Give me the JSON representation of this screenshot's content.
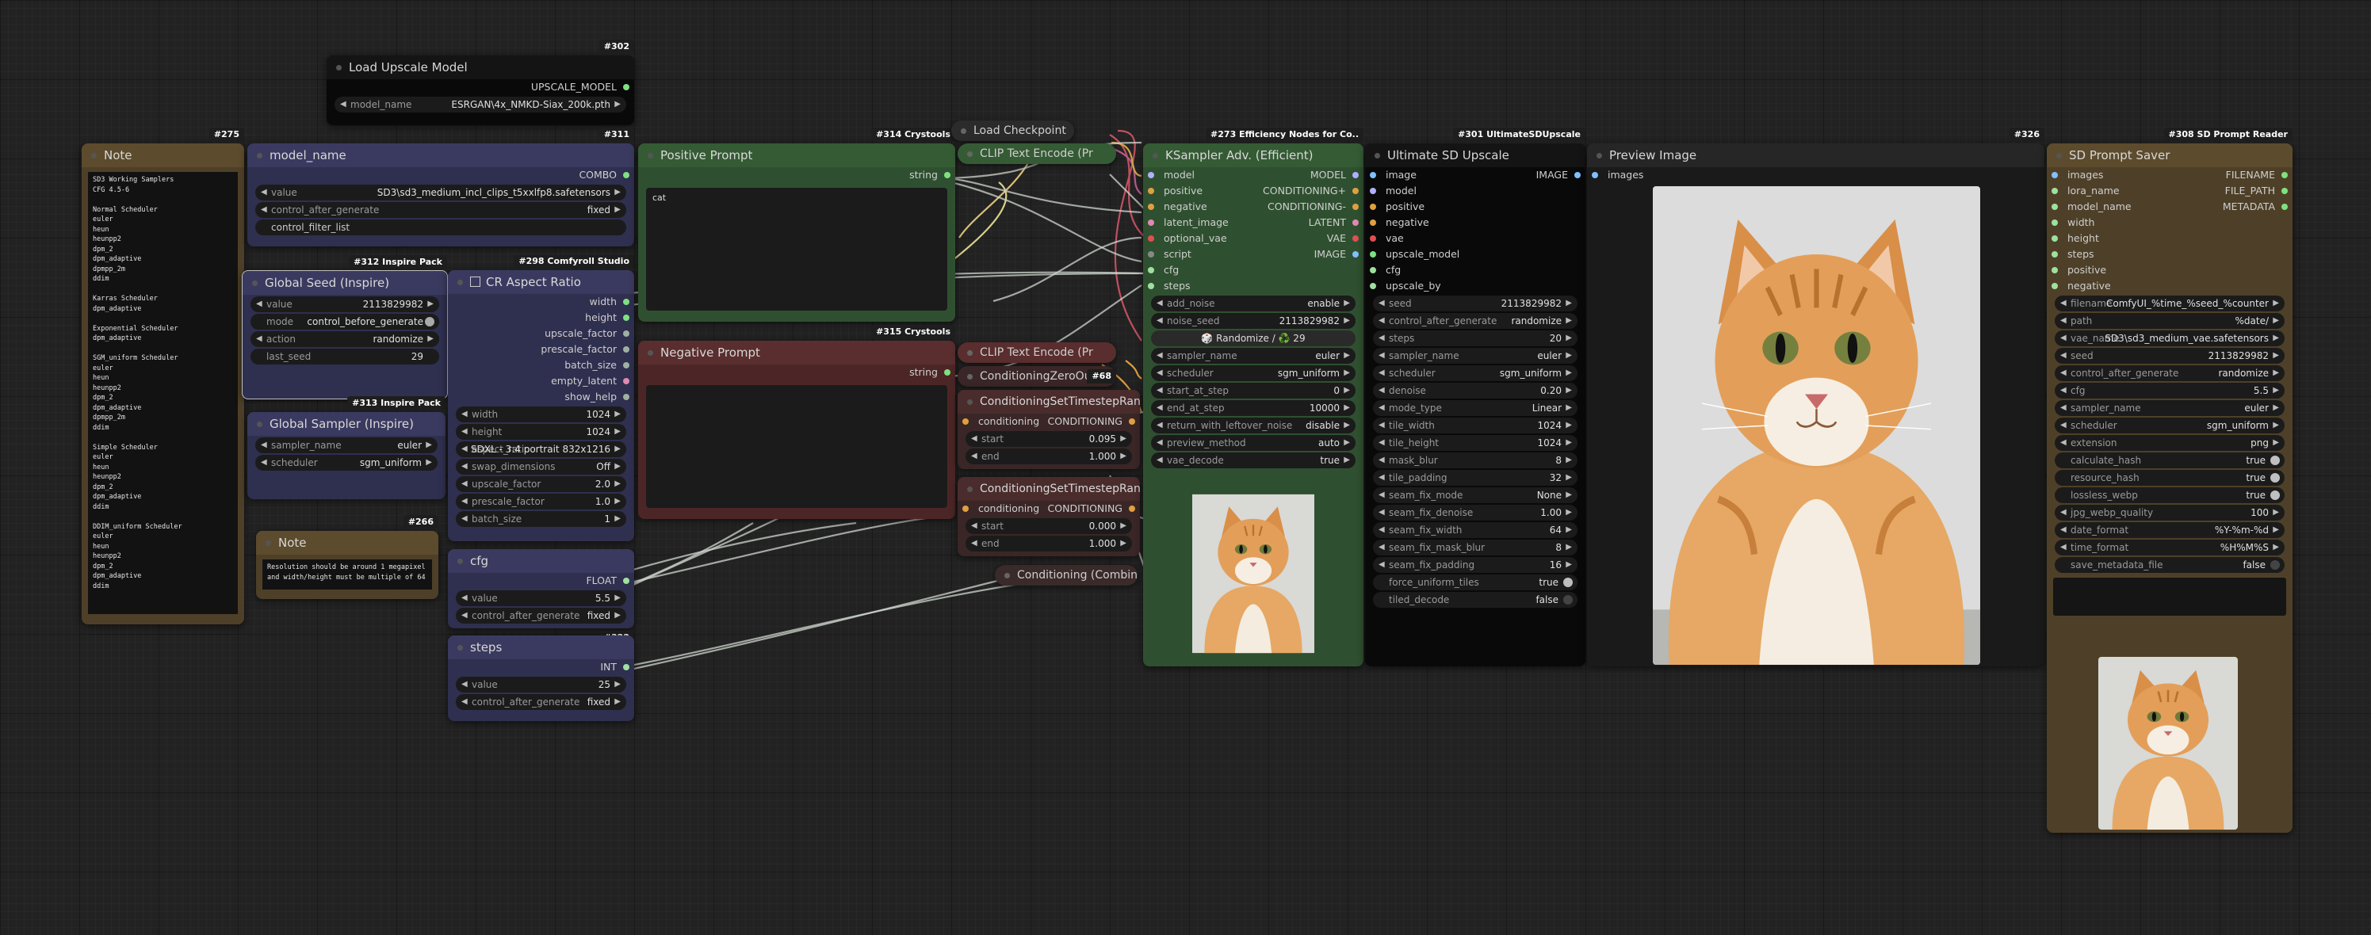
{
  "colors": {
    "bg": "#222222",
    "purple": "#2f2f4f",
    "purpleHdr": "#3a3a60",
    "green": "#2f5030",
    "greenHdr": "#355b35",
    "red": "#4c2626",
    "redHdr": "#5a2e2e",
    "brown": "#4e4028",
    "brownHdr": "#5d4b2d",
    "black": "#090909",
    "gray": "#2b2b2b"
  },
  "note1": {
    "badge": "#275",
    "title": "Note",
    "text": "SD3 Working Samplers\nCFG 4.5-6\n\nNormal Scheduler\neuler\nheun\nheunpp2\ndpm_2\ndpm_adaptive\ndpmpp_2m\nddim\n\nKarras Scheduler\ndpm_adaptive\n\nExponential Scheduler\ndpm_adaptive\n\nSGM_uniform Scheduler\neuler\nheun\nheunpp2\ndpm_2\ndpm_adaptive\ndpmpp_2m\nddim\n\nSimple Scheduler\neuler\nheun\nheunpp2\ndpm_2\ndpm_adaptive\nddim\n\nDDIM_uniform Scheduler\neuler\nheun\nheunpp2\ndpm_2\ndpm_adaptive\nddim"
  },
  "note2": {
    "badge": "#266",
    "title": "Note",
    "text": "Resolution should be around 1 megapixel\nand width/height must be multiple of 64"
  },
  "upscale_model": {
    "badge": "#302",
    "title": "Load Upscale Model",
    "out": "UPSCALE_MODEL",
    "w_label": "model_name",
    "w_value": "ESRGAN\\4x_NMKD-Siax_200k.pth"
  },
  "model_name": {
    "badge": "#311",
    "title": "model_name",
    "out": "COMBO",
    "w1_label": "value",
    "w1_value": "SD3\\sd3_medium_incl_clips_t5xxlfp8.safetensors",
    "w2_label": "control_after_generate",
    "w2_value": "fixed",
    "w3_label": "control_filter_list"
  },
  "global_seed": {
    "badge": "#312 Inspire Pack",
    "title": "Global Seed (Inspire)",
    "rows": [
      {
        "l": "value",
        "v": "2113829982"
      },
      {
        "l": "mode",
        "v": "control_before_generate"
      },
      {
        "l": "action",
        "v": "randomize"
      },
      {
        "l": "last_seed",
        "v": "29"
      }
    ]
  },
  "global_sampler": {
    "badge": "#313 Inspire Pack",
    "title": "Global Sampler (Inspire)",
    "rows": [
      {
        "l": "sampler_name",
        "v": "euler"
      },
      {
        "l": "scheduler",
        "v": "sgm_uniform"
      }
    ]
  },
  "aspect": {
    "badge": "#298 Comfyroll Studio",
    "title": "CR Aspect Ratio",
    "outs": [
      "width",
      "height",
      "upscale_factor",
      "prescale_factor",
      "batch_size",
      "empty_latent",
      "show_help"
    ],
    "rows": [
      {
        "l": "width",
        "v": "1024"
      },
      {
        "l": "height",
        "v": "1024"
      },
      {
        "l": "aspect_ratio",
        "v": "SDXL - 3:4 portrait 832x1216"
      },
      {
        "l": "swap_dimensions",
        "v": "Off"
      },
      {
        "l": "upscale_factor",
        "v": "2.0"
      },
      {
        "l": "prescale_factor",
        "v": "1.0"
      },
      {
        "l": "batch_size",
        "v": "1"
      }
    ]
  },
  "cfg": {
    "title": "cfg",
    "out": "FLOAT",
    "rows": [
      {
        "l": "value",
        "v": "5.5"
      },
      {
        "l": "control_after_generate",
        "v": "fixed"
      }
    ],
    "badge2": "#322"
  },
  "steps": {
    "title": "steps",
    "out": "INT",
    "rows": [
      {
        "l": "value",
        "v": "25"
      },
      {
        "l": "control_after_generate",
        "v": "fixed"
      }
    ]
  },
  "positive": {
    "badge": "#314 Crystools",
    "title": "Positive Prompt",
    "out": "string",
    "text": "cat"
  },
  "negative": {
    "badge": "#315 Crystools",
    "title": "Negative Prompt",
    "out": "string",
    "text": ""
  },
  "load_checkpoint": {
    "title": "Load Checkpoint"
  },
  "clip1": {
    "title": "CLIP Text Encode (Pr"
  },
  "clip2": {
    "title": "CLIP Text Encode (Pr"
  },
  "zeroout": {
    "title": "ConditioningZeroOut",
    "badge": "#68"
  },
  "ts1": {
    "title": "ConditioningSetTimestepRange",
    "in": "conditioning",
    "out": "CONDITIONING",
    "rows": [
      {
        "l": "start",
        "v": "0.095"
      },
      {
        "l": "end",
        "v": "1.000"
      }
    ]
  },
  "ts2": {
    "title": "ConditioningSetTimestepRange",
    "in": "conditioning",
    "out": "CONDITIONING",
    "rows": [
      {
        "l": "start",
        "v": "0.000"
      },
      {
        "l": "end",
        "v": "1.000"
      }
    ]
  },
  "combine": {
    "title": "Conditioning (Combin"
  },
  "ksampler": {
    "badge": "#273 Efficiency Nodes for Co..",
    "title": "KSampler Adv. (Efficient)",
    "ins": [
      "model",
      "positive",
      "negative",
      "latent_image",
      "optional_vae",
      "script",
      "cfg",
      "steps"
    ],
    "outs": [
      "MODEL",
      "CONDITIONING+",
      "CONDITIONING-",
      "LATENT",
      "VAE",
      "IMAGE"
    ],
    "rows": [
      {
        "l": "add_noise",
        "v": "enable"
      },
      {
        "l": "noise_seed",
        "v": "2113829982"
      },
      {
        "l": "",
        "v": "🎲 Randomize / ♻️ 29"
      },
      {
        "l": "sampler_name",
        "v": "euler"
      },
      {
        "l": "scheduler",
        "v": "sgm_uniform"
      },
      {
        "l": "start_at_step",
        "v": "0"
      },
      {
        "l": "end_at_step",
        "v": "10000"
      },
      {
        "l": "return_with_leftover_noise",
        "v": "disable"
      },
      {
        "l": "preview_method",
        "v": "auto"
      },
      {
        "l": "vae_decode",
        "v": "true"
      }
    ]
  },
  "upscale": {
    "badge": "#301 UltimateSDUpscale",
    "title": "Ultimate SD Upscale",
    "ins": [
      "image",
      "model",
      "positive",
      "negative",
      "vae",
      "upscale_model",
      "cfg",
      "upscale_by"
    ],
    "out": "IMAGE",
    "rows": [
      {
        "l": "seed",
        "v": "2113829982"
      },
      {
        "l": "control_after_generate",
        "v": "randomize"
      },
      {
        "l": "steps",
        "v": "20"
      },
      {
        "l": "sampler_name",
        "v": "euler"
      },
      {
        "l": "scheduler",
        "v": "sgm_uniform"
      },
      {
        "l": "denoise",
        "v": "0.20"
      },
      {
        "l": "mode_type",
        "v": "Linear"
      },
      {
        "l": "tile_width",
        "v": "1024"
      },
      {
        "l": "tile_height",
        "v": "1024"
      },
      {
        "l": "mask_blur",
        "v": "8"
      },
      {
        "l": "tile_padding",
        "v": "32"
      },
      {
        "l": "seam_fix_mode",
        "v": "None"
      },
      {
        "l": "seam_fix_denoise",
        "v": "1.00"
      },
      {
        "l": "seam_fix_width",
        "v": "64"
      },
      {
        "l": "seam_fix_mask_blur",
        "v": "8"
      },
      {
        "l": "seam_fix_padding",
        "v": "16"
      },
      {
        "l": "force_uniform_tiles",
        "v": "true"
      },
      {
        "l": "tiled_decode",
        "v": "false"
      }
    ]
  },
  "preview": {
    "badge": "#326",
    "title": "Preview Image",
    "in": "images"
  },
  "saver": {
    "badge": "#308 SD Prompt Reader",
    "title": "SD Prompt Saver",
    "ins": [
      "images",
      "lora_name",
      "model_name",
      "width",
      "height",
      "steps",
      "positive",
      "negative"
    ],
    "outs": [
      "FILENAME",
      "FILE_PATH",
      "METADATA"
    ],
    "rows": [
      {
        "l": "filename",
        "v": "ComfyUI_%time_%seed_%counter"
      },
      {
        "l": "path",
        "v": "%date/"
      },
      {
        "l": "vae_name",
        "v": "SD3\\sd3_medium_vae.safetensors"
      },
      {
        "l": "seed",
        "v": "2113829982"
      },
      {
        "l": "control_after_generate",
        "v": "randomize"
      },
      {
        "l": "cfg",
        "v": "5.5"
      },
      {
        "l": "sampler_name",
        "v": "euler"
      },
      {
        "l": "scheduler",
        "v": "sgm_uniform"
      },
      {
        "l": "extension",
        "v": "png"
      },
      {
        "l": "calculate_hash",
        "v": "true"
      },
      {
        "l": "resource_hash",
        "v": "true"
      },
      {
        "l": "lossless_webp",
        "v": "true"
      },
      {
        "l": "jpg_webp_quality",
        "v": "100"
      },
      {
        "l": "date_format",
        "v": "%Y-%m-%d"
      },
      {
        "l": "time_format",
        "v": "%H%M%S"
      },
      {
        "l": "save_metadata_file",
        "v": "false"
      }
    ]
  }
}
